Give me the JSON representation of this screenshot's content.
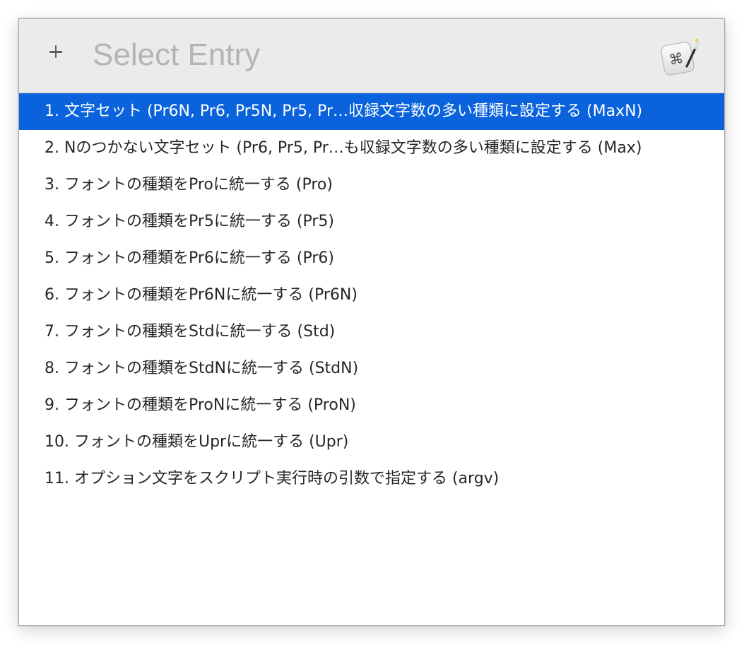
{
  "search": {
    "placeholder": "Select Entry",
    "value": ""
  },
  "header": {
    "add_icon": "plus-icon",
    "app_icon": "keyboard-maestro-app-icon"
  },
  "colors": {
    "selection": "#0a63dc",
    "header_background": "#ebebeb"
  },
  "entries": [
    {
      "label": "1. 文字セット (Pr6N, Pr6, Pr5N, Pr5, Pr…収録文字数の多い種類に設定する (MaxN)",
      "selected": true
    },
    {
      "label": "2. Nのつかない文字セット (Pr6, Pr5, Pr…も収録文字数の多い種類に設定する (Max)",
      "selected": false
    },
    {
      "label": "3. フォントの種類をProに統一する (Pro)",
      "selected": false
    },
    {
      "label": "4. フォントの種類をPr5に統一する (Pr5)",
      "selected": false
    },
    {
      "label": "5. フォントの種類をPr6に統一する (Pr6)",
      "selected": false
    },
    {
      "label": "6. フォントの種類をPr6Nに統一する (Pr6N)",
      "selected": false
    },
    {
      "label": "7. フォントの種類をStdに統一する (Std)",
      "selected": false
    },
    {
      "label": "8. フォントの種類をStdNに統一する (StdN)",
      "selected": false
    },
    {
      "label": "9. フォントの種類をProNに統一する (ProN)",
      "selected": false
    },
    {
      "label": "10. フォントの種類をUprに統一する (Upr)",
      "selected": false
    },
    {
      "label": "11. オプション文字をスクリプト実行時の引数で指定する (argv)",
      "selected": false
    }
  ]
}
